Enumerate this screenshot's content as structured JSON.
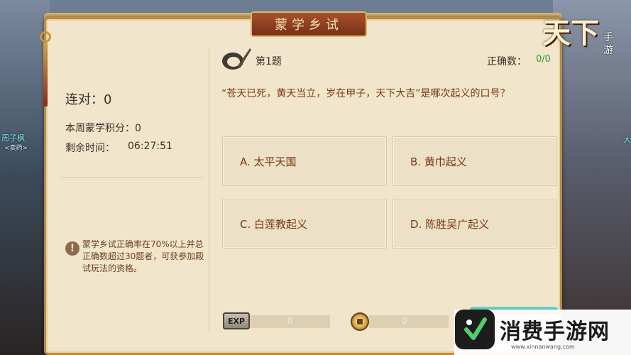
{
  "window": {
    "title": "蒙学乡试",
    "logo_big": "天下",
    "logo_small_1": "手",
    "logo_small_2": "游"
  },
  "scene": {
    "npc_left_name": "周子枫",
    "npc_left_sub": "<卖药>",
    "npc_right_name": "大"
  },
  "stats": {
    "streak_label": "连对：",
    "streak_value": "0",
    "weekly_label": "本周蒙学积分：",
    "weekly_value": "0",
    "time_label": "剩余时间：",
    "time_value": "06:27:51"
  },
  "notice": {
    "text": "蒙学乡试正确率在70%以上并总正确数超过30题者，可获参加殿试玩法的资格。"
  },
  "quiz": {
    "number": "第1题",
    "correct_label": "正确数：",
    "correct_value": "0/0",
    "question": "“苍天已死，黄天当立，岁在甲子，天下大吉”是哪次起义的口号？",
    "options": [
      {
        "label": "A. 太平天国"
      },
      {
        "label": "B. 黄巾起义"
      },
      {
        "label": "C. 白莲教起义"
      },
      {
        "label": "D. 陈胜吴广起义"
      }
    ]
  },
  "rewards": {
    "exp_badge": "EXP",
    "exp_value": "0",
    "coin_value": "0"
  },
  "watermark": {
    "text": "消费手游网",
    "url": "www.xinnanwang.com"
  }
}
